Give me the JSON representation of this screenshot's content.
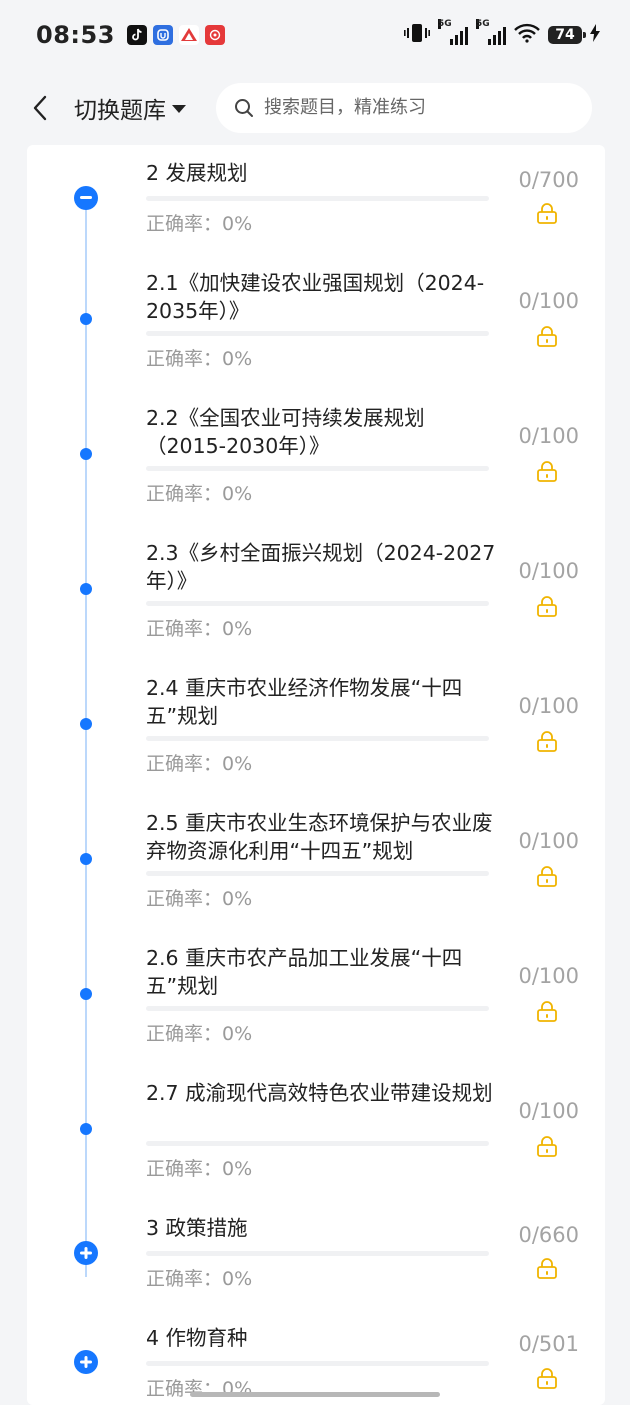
{
  "status_bar": {
    "time": "08:53",
    "signal_1_label": "5G",
    "signal_2_label": "5G",
    "battery": "74"
  },
  "header": {
    "switch_label": "切换题库",
    "search_placeholder": "搜索题目，精准练习"
  },
  "colors": {
    "accent": "#1677ff",
    "lock": "#f0b400",
    "timeline": "#bcd8fb"
  },
  "items": [
    {
      "title": "2 发展规划",
      "accuracy": "正确率：0%",
      "count": "0/700",
      "node": "minus"
    },
    {
      "title": "2.1《加快建设农业强国规划（2024-2035年）》",
      "accuracy": "正确率：0%",
      "count": "0/100",
      "node": "dot"
    },
    {
      "title": "2.2《全国农业可持续发展规划（2015-2030年）》",
      "accuracy": "正确率：0%",
      "count": "0/100",
      "node": "dot"
    },
    {
      "title": "2.3《乡村全面振兴规划（2024-2027年）》",
      "accuracy": "正确率：0%",
      "count": "0/100",
      "node": "dot"
    },
    {
      "title": "2.4 重庆市农业经济作物发展“十四五”规划",
      "accuracy": "正确率：0%",
      "count": "0/100",
      "node": "dot"
    },
    {
      "title": "2.5 重庆市农业生态环境保护与农业废弃物资源化利用“十四五”规划",
      "accuracy": "正确率：0%",
      "count": "0/100",
      "node": "dot"
    },
    {
      "title": "2.6 重庆市农产品加工业发展“十四五”规划",
      "accuracy": "正确率：0%",
      "count": "0/100",
      "node": "dot"
    },
    {
      "title": "2.7 成渝现代高效特色农业带建设规划",
      "accuracy": "正确率：0%",
      "count": "0/100",
      "node": "dot"
    },
    {
      "title": "3 政策措施",
      "accuracy": "正确率：0%",
      "count": "0/660",
      "node": "plus"
    },
    {
      "title": "4 作物育种",
      "accuracy": "正确率：0%",
      "count": "0/501",
      "node": "plus"
    }
  ]
}
